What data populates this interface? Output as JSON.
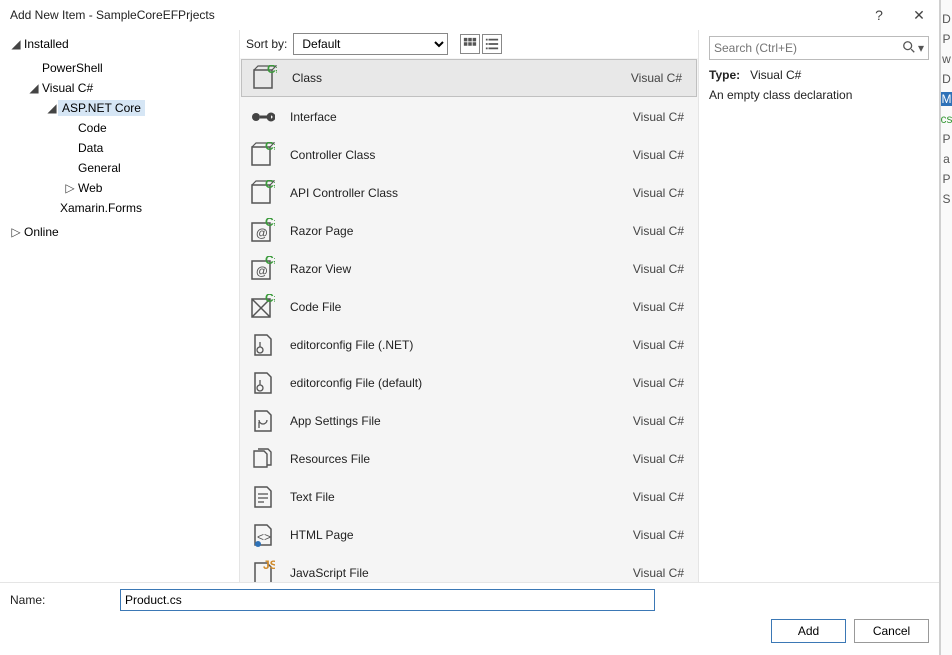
{
  "window": {
    "title": "Add New Item - SampleCoreEFPrjects",
    "help": "?",
    "close": "✕"
  },
  "sidebar": {
    "header": "Installed",
    "items": [
      {
        "label": "PowerShell",
        "indent": 1,
        "arrow": ""
      },
      {
        "label": "Visual C#",
        "indent": 1,
        "arrow": "◢"
      },
      {
        "label": "ASP.NET Core",
        "indent": 2,
        "arrow": "◢",
        "selected": true
      },
      {
        "label": "Code",
        "indent": 3,
        "arrow": ""
      },
      {
        "label": "Data",
        "indent": 3,
        "arrow": ""
      },
      {
        "label": "General",
        "indent": 3,
        "arrow": ""
      },
      {
        "label": "Web",
        "indent": 3,
        "arrow": "▷"
      },
      {
        "label": "Xamarin.Forms",
        "indent": 2,
        "arrow": ""
      }
    ],
    "online": "Online"
  },
  "toolbar": {
    "sort_label": "Sort by:",
    "sort_value": "Default"
  },
  "templates": [
    {
      "name": "Class",
      "lang": "Visual C#",
      "icon": "cs-class",
      "selected": true
    },
    {
      "name": "Interface",
      "lang": "Visual C#",
      "icon": "interface"
    },
    {
      "name": "Controller Class",
      "lang": "Visual C#",
      "icon": "cs-class"
    },
    {
      "name": "API Controller Class",
      "lang": "Visual C#",
      "icon": "cs-class"
    },
    {
      "name": "Razor Page",
      "lang": "Visual C#",
      "icon": "razor"
    },
    {
      "name": "Razor View",
      "lang": "Visual C#",
      "icon": "razor"
    },
    {
      "name": "Code File",
      "lang": "Visual C#",
      "icon": "codefile"
    },
    {
      "name": "editorconfig File (.NET)",
      "lang": "Visual C#",
      "icon": "config"
    },
    {
      "name": "editorconfig File (default)",
      "lang": "Visual C#",
      "icon": "config"
    },
    {
      "name": "App Settings File",
      "lang": "Visual C#",
      "icon": "settings"
    },
    {
      "name": "Resources File",
      "lang": "Visual C#",
      "icon": "files"
    },
    {
      "name": "Text File",
      "lang": "Visual C#",
      "icon": "text"
    },
    {
      "name": "HTML Page",
      "lang": "Visual C#",
      "icon": "html"
    },
    {
      "name": "JavaScript File",
      "lang": "Visual C#",
      "icon": "js"
    }
  ],
  "details": {
    "search_placeholder": "Search (Ctrl+E)",
    "type_label": "Type:",
    "type_value": "Visual C#",
    "description": "An empty class declaration"
  },
  "footer": {
    "name_label": "Name:",
    "name_value": "Product.cs",
    "add": "Add",
    "cancel": "Cancel"
  },
  "sliver": [
    "D",
    "P",
    "w",
    "D",
    "M",
    "cs",
    "P",
    "a",
    "P",
    "S"
  ]
}
